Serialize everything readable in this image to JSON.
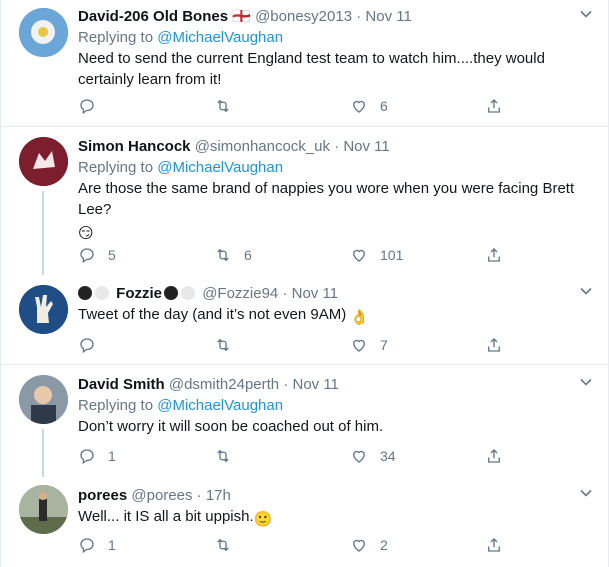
{
  "tweets": [
    {
      "name": "David-206 Old Bones",
      "name_suffix": "🏴󠁧󠁢󠁥󠁮󠁧󠁿",
      "handle": "@bonesy2013",
      "sep": "·",
      "date": "Nov 11",
      "replying_label": "Replying to",
      "replying_to": "@MichaelVaughan",
      "text_line1": "Need to send the current England test team to watch him....they would",
      "text_line2": "certainly learn from it!",
      "reply_count": "",
      "retweet_count": "",
      "like_count": "6"
    },
    {
      "name": "Simon Hancock",
      "handle": "@simonhancock_uk",
      "sep": "·",
      "date": "Nov 11",
      "replying_label": "Replying to",
      "replying_to": "@MichaelVaughan",
      "text_line1": "Are those the same brand of nappies you wore when you were facing Brett",
      "text_line2": "Lee?",
      "emoji": "😏",
      "reply_count": "5",
      "retweet_count": "6",
      "like_count": "101"
    },
    {
      "name": "Fozzie",
      "handle": "@Fozzie94",
      "sep": "·",
      "date": "Nov 11",
      "text_line1": "Tweet of the day (and it’s not even 9AM)",
      "emoji": "👌",
      "reply_count": "",
      "retweet_count": "",
      "like_count": "7"
    },
    {
      "name": "David Smith",
      "handle": "@dsmith24perth",
      "sep": "·",
      "date": "Nov 11",
      "replying_label": "Replying to",
      "replying_to": "@MichaelVaughan",
      "text_line1": "Don’t worry it will soon be coached out of him.",
      "reply_count": "1",
      "retweet_count": "",
      "like_count": "34"
    },
    {
      "name": "porees",
      "handle": "@porees",
      "sep": "·",
      "date": "17h",
      "text_line1": "Well... it IS all a bit uppish.",
      "emoji": "🙂",
      "reply_count": "1",
      "retweet_count": "",
      "like_count": "2"
    }
  ],
  "colors": {
    "muted": "#657786",
    "link": "#1b95e0",
    "border": "#e6ecf0",
    "thread": "#ccd6dd"
  },
  "icons": [
    "reply-icon",
    "retweet-icon",
    "like-icon",
    "share-icon",
    "chevron-down-icon"
  ]
}
